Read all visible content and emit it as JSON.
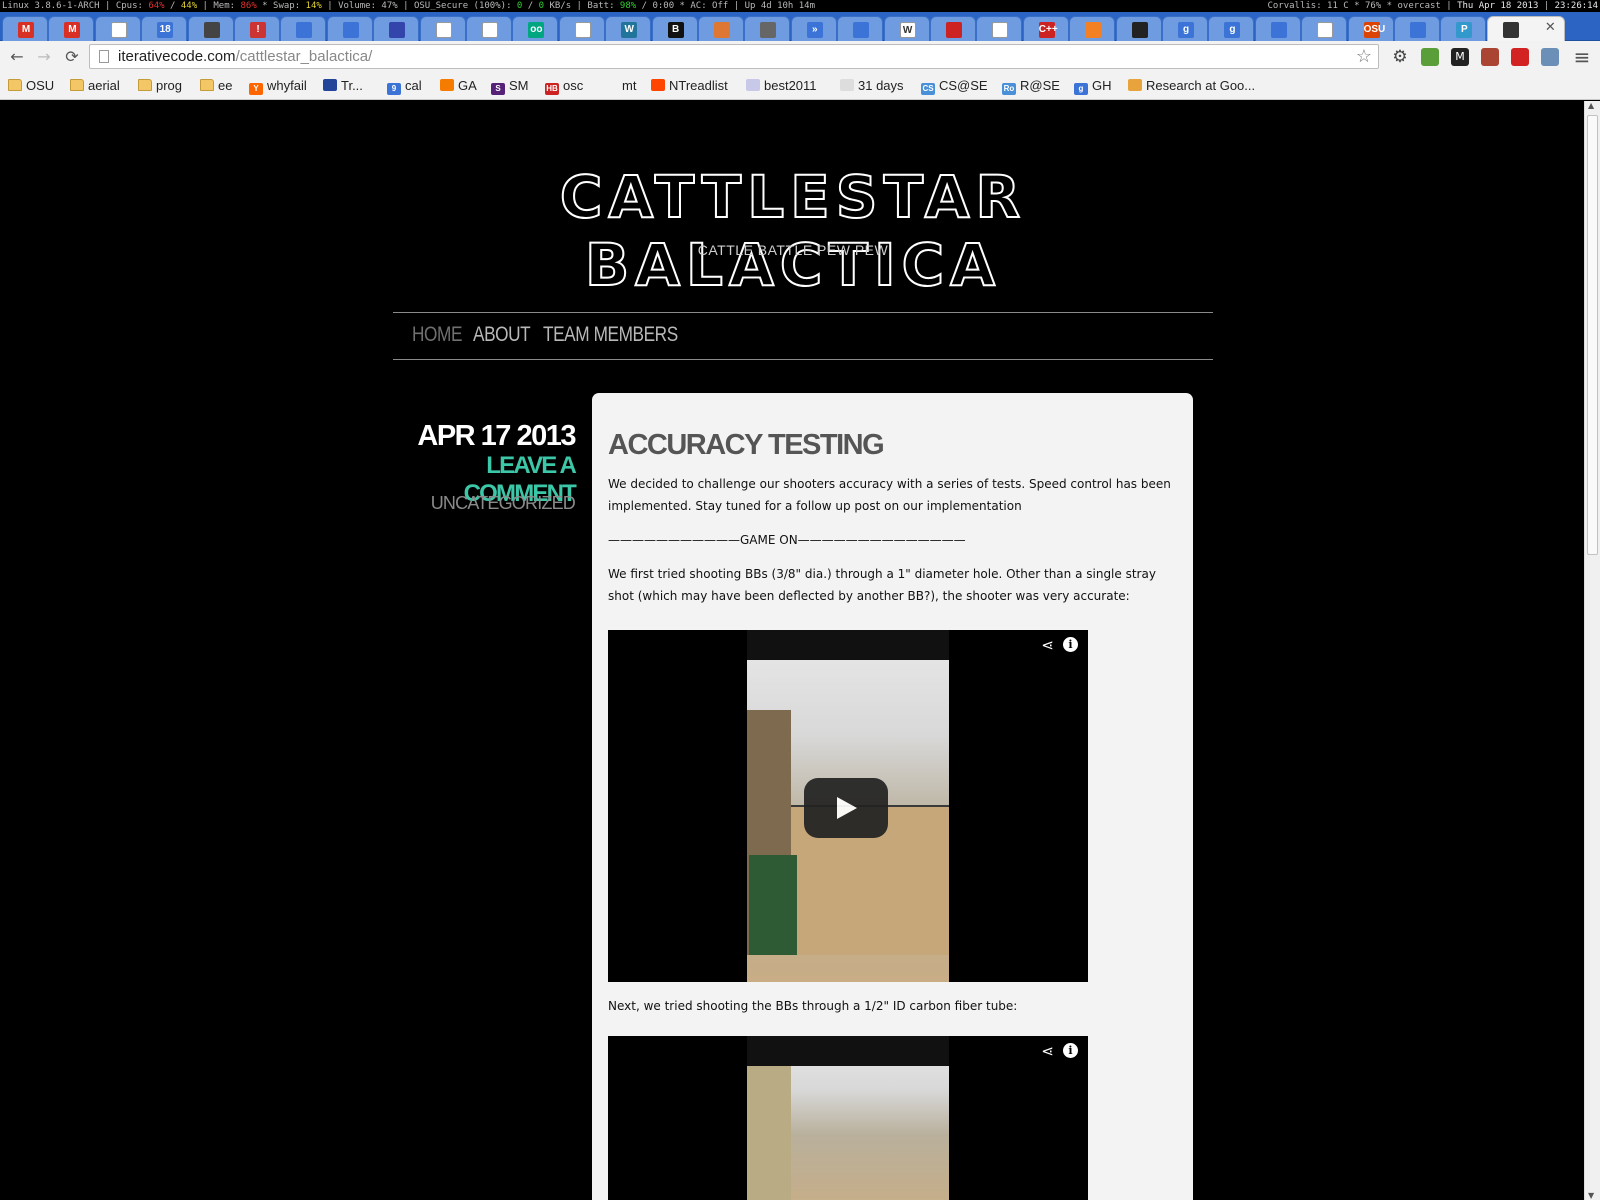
{
  "system_bar": {
    "os": "Linux 3.8.6-1-ARCH",
    "cpus_label": "Cpus:",
    "cpu1": "64%",
    "cpu2": "44%",
    "mem_label": "Mem:",
    "mem": "86%",
    "swap_label": "Swap:",
    "swap": "14%",
    "volume": "Volume: 47%",
    "network": "OSU_Secure (100%):",
    "net_in": "0",
    "net_out": "0",
    "net_unit": "KB/s",
    "batt_label": "Batt:",
    "batt": "98%",
    "batt_rest": "/ 0:00 * AC: Off",
    "uptime": "Up 4d 10h 14m",
    "weather": "Corvallis: 11 C * 76% * overcast",
    "date": "Thu Apr 18 2013",
    "time": "23:26:14"
  },
  "tabs": [
    {
      "icon": "gmail-icon",
      "glyph": "M",
      "color": "#d93025"
    },
    {
      "icon": "gmail-icon",
      "glyph": "M",
      "color": "#d93025"
    },
    {
      "icon": "doc-icon",
      "glyph": "",
      "color": "#ffffff"
    },
    {
      "icon": "calendar-icon",
      "glyph": "18",
      "color": "#3b73d6"
    },
    {
      "icon": "book-icon",
      "glyph": "",
      "color": "#444444"
    },
    {
      "icon": "alert-icon",
      "glyph": "!",
      "color": "#cc3333"
    },
    {
      "icon": "doc-blue-icon",
      "glyph": "",
      "color": "#3b73d6"
    },
    {
      "icon": "translate-icon",
      "glyph": "",
      "color": "#3b73d6"
    },
    {
      "icon": "grid-icon",
      "glyph": "",
      "color": "#3344aa"
    },
    {
      "icon": "doc-icon",
      "glyph": "",
      "color": "#ffffff"
    },
    {
      "icon": "doc-icon",
      "glyph": "",
      "color": "#ffffff"
    },
    {
      "icon": "tripadvisor-icon",
      "glyph": "oo",
      "color": "#00a680"
    },
    {
      "icon": "doc-icon",
      "glyph": "",
      "color": "#ffffff"
    },
    {
      "icon": "wordpress-icon",
      "glyph": "W",
      "color": "#21759b"
    },
    {
      "icon": "bold-b-icon",
      "glyph": "B",
      "color": "#111111"
    },
    {
      "icon": "pen-icon",
      "glyph": "",
      "color": "#dd7733"
    },
    {
      "icon": "figure-icon",
      "glyph": "",
      "color": "#666666"
    },
    {
      "icon": "forward-icon",
      "glyph": "»",
      "color": "#3b73d6"
    },
    {
      "icon": "translate-icon",
      "glyph": "",
      "color": "#3b73d6"
    },
    {
      "icon": "wikipedia-icon",
      "glyph": "W",
      "color": "#ffffff"
    },
    {
      "icon": "flag-icon",
      "glyph": "",
      "color": "#cc2222"
    },
    {
      "icon": "doc-icon",
      "glyph": "",
      "color": "#ffffff"
    },
    {
      "icon": "cpp-icon",
      "glyph": "C++",
      "color": "#cc2222"
    },
    {
      "icon": "stackoverflow-icon",
      "glyph": "",
      "color": "#f48024"
    },
    {
      "icon": "github-icon",
      "glyph": "",
      "color": "#222222"
    },
    {
      "icon": "google-icon",
      "glyph": "g",
      "color": "#3b73d6"
    },
    {
      "icon": "google-icon",
      "glyph": "g",
      "color": "#3b73d6"
    },
    {
      "icon": "translate-icon",
      "glyph": "",
      "color": "#3b73d6"
    },
    {
      "icon": "doc-icon",
      "glyph": "",
      "color": "#ffffff"
    },
    {
      "icon": "osu-coe-icon",
      "glyph": "OSU",
      "color": "#dc4405"
    },
    {
      "icon": "translate-icon",
      "glyph": "",
      "color": "#3b73d6"
    },
    {
      "icon": "p-icon",
      "glyph": "P",
      "color": "#3399cc"
    }
  ],
  "active_tab": {
    "icon": "blog-icon",
    "close": "✕"
  },
  "toolbar": {
    "back": "←",
    "forward": "→",
    "reload": "⟳",
    "url_domain": "iterativecode.com",
    "url_path": "/cattlestar_balactica/",
    "star": "☆",
    "menu": "≡"
  },
  "extensions": [
    {
      "icon": "gear-icon",
      "glyph": "⚙",
      "color": "#444444"
    },
    {
      "icon": "extension-green-icon",
      "glyph": "",
      "color": "#5a9e3a"
    },
    {
      "icon": "m-icon",
      "glyph": "M",
      "color": "#222222"
    },
    {
      "icon": "book-open-icon",
      "glyph": "",
      "color": "#aa4433"
    },
    {
      "icon": "stop-icon",
      "glyph": "",
      "color": "#d22222"
    },
    {
      "icon": "window-icon",
      "glyph": "",
      "color": "#6c8fb8"
    }
  ],
  "bookmarks": [
    {
      "label": "OSU",
      "icon": "folder-icon",
      "type": "folder"
    },
    {
      "label": "aerial",
      "icon": "folder-icon",
      "type": "folder"
    },
    {
      "label": "prog",
      "icon": "folder-icon",
      "type": "folder"
    },
    {
      "label": "ee",
      "icon": "folder-icon",
      "type": "folder"
    },
    {
      "label": "whyfail",
      "icon": "hackernews-icon",
      "type": "site",
      "color": "#ff6600",
      "glyph": "Y"
    },
    {
      "label": "Tr...",
      "icon": "mountain-icon",
      "type": "site",
      "color": "#224499",
      "glyph": ""
    },
    {
      "label": "cal",
      "icon": "calendar-icon",
      "type": "site",
      "color": "#3b73d6",
      "glyph": "9"
    },
    {
      "label": "GA",
      "icon": "analytics-icon",
      "type": "site",
      "color": "#f57c00",
      "glyph": ""
    },
    {
      "label": "SM",
      "icon": "sm-icon",
      "type": "site",
      "color": "#552277",
      "glyph": "S"
    },
    {
      "label": "osc",
      "icon": "hb-icon",
      "type": "site",
      "color": "#cc2222",
      "glyph": "HB"
    },
    {
      "label": "mt",
      "icon": "blank-icon",
      "type": "site",
      "color": "transparent",
      "glyph": ""
    },
    {
      "label": "NTreadlist",
      "icon": "reddit-icon",
      "type": "site",
      "color": "#ff4500",
      "glyph": ""
    },
    {
      "label": "best2011",
      "icon": "circle-icon",
      "type": "site",
      "color": "#c8c8e8",
      "glyph": ""
    },
    {
      "label": "31 days",
      "icon": "leaf-icon",
      "type": "site",
      "color": "#dddddd",
      "glyph": ""
    },
    {
      "label": "CS@SE",
      "icon": "cs-icon",
      "type": "site",
      "color": "#4a90d9",
      "glyph": "CS"
    },
    {
      "label": "R@SE",
      "icon": "ro-icon",
      "type": "site",
      "color": "#4a90d9",
      "glyph": "Ro"
    },
    {
      "label": "GH",
      "icon": "google-icon",
      "type": "site",
      "color": "#3b73d6",
      "glyph": "g"
    },
    {
      "label": "Research at Goo...",
      "icon": "google-color-icon",
      "type": "site",
      "color": "#e8a33c",
      "glyph": ""
    }
  ],
  "site": {
    "title": "CATTLESTAR BALACTICA",
    "tagline": "CATTLE BATTLE PEW PEW",
    "menu": [
      {
        "label": "HOME",
        "active": true
      },
      {
        "label": "ABOUT",
        "active": false
      },
      {
        "label": "TEAM MEMBERS",
        "active": false
      }
    ]
  },
  "post": {
    "date": "APR 17 2013",
    "comment_link": "LEAVE A COMMENT",
    "category": "UNCATEGORIZED",
    "title": "ACCURACY TESTING",
    "paragraphs": [
      "We decided to challenge our shooters accuracy with a series of tests.  Speed control has been implemented. Stay tuned for a follow up post on our implementation",
      "———————————GAME ON——————————————",
      "We first tried shooting BBs (3/8\" dia.) through a 1\" diameter hole. Other than a single stray shot (which may have been deflected by another BB?), the shooter was very accurate:",
      "Next, we tried shooting the BBs through a 1/2\" ID carbon fiber tube:"
    ],
    "video1": {
      "share": "⋖",
      "info": "i"
    },
    "video2": {
      "share": "⋖",
      "info": "i"
    }
  }
}
